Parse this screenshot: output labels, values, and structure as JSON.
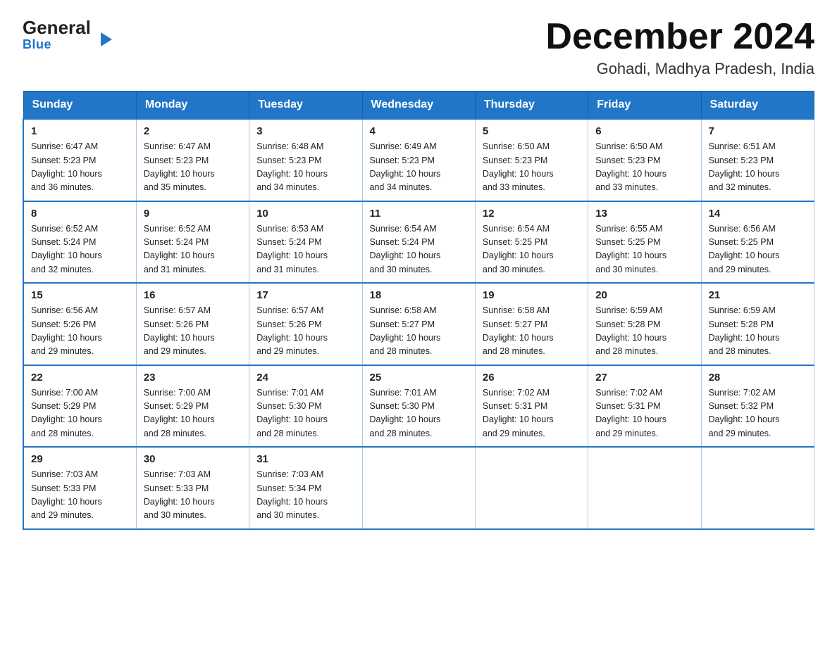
{
  "logo": {
    "general": "General",
    "arrow": "▶",
    "blue": "Blue"
  },
  "header": {
    "month_year": "December 2024",
    "location": "Gohadi, Madhya Pradesh, India"
  },
  "days_of_week": [
    "Sunday",
    "Monday",
    "Tuesday",
    "Wednesday",
    "Thursday",
    "Friday",
    "Saturday"
  ],
  "weeks": [
    [
      {
        "day": "1",
        "sunrise": "6:47 AM",
        "sunset": "5:23 PM",
        "daylight": "10 hours and 36 minutes."
      },
      {
        "day": "2",
        "sunrise": "6:47 AM",
        "sunset": "5:23 PM",
        "daylight": "10 hours and 35 minutes."
      },
      {
        "day": "3",
        "sunrise": "6:48 AM",
        "sunset": "5:23 PM",
        "daylight": "10 hours and 34 minutes."
      },
      {
        "day": "4",
        "sunrise": "6:49 AM",
        "sunset": "5:23 PM",
        "daylight": "10 hours and 34 minutes."
      },
      {
        "day": "5",
        "sunrise": "6:50 AM",
        "sunset": "5:23 PM",
        "daylight": "10 hours and 33 minutes."
      },
      {
        "day": "6",
        "sunrise": "6:50 AM",
        "sunset": "5:23 PM",
        "daylight": "10 hours and 33 minutes."
      },
      {
        "day": "7",
        "sunrise": "6:51 AM",
        "sunset": "5:23 PM",
        "daylight": "10 hours and 32 minutes."
      }
    ],
    [
      {
        "day": "8",
        "sunrise": "6:52 AM",
        "sunset": "5:24 PM",
        "daylight": "10 hours and 32 minutes."
      },
      {
        "day": "9",
        "sunrise": "6:52 AM",
        "sunset": "5:24 PM",
        "daylight": "10 hours and 31 minutes."
      },
      {
        "day": "10",
        "sunrise": "6:53 AM",
        "sunset": "5:24 PM",
        "daylight": "10 hours and 31 minutes."
      },
      {
        "day": "11",
        "sunrise": "6:54 AM",
        "sunset": "5:24 PM",
        "daylight": "10 hours and 30 minutes."
      },
      {
        "day": "12",
        "sunrise": "6:54 AM",
        "sunset": "5:25 PM",
        "daylight": "10 hours and 30 minutes."
      },
      {
        "day": "13",
        "sunrise": "6:55 AM",
        "sunset": "5:25 PM",
        "daylight": "10 hours and 30 minutes."
      },
      {
        "day": "14",
        "sunrise": "6:56 AM",
        "sunset": "5:25 PM",
        "daylight": "10 hours and 29 minutes."
      }
    ],
    [
      {
        "day": "15",
        "sunrise": "6:56 AM",
        "sunset": "5:26 PM",
        "daylight": "10 hours and 29 minutes."
      },
      {
        "day": "16",
        "sunrise": "6:57 AM",
        "sunset": "5:26 PM",
        "daylight": "10 hours and 29 minutes."
      },
      {
        "day": "17",
        "sunrise": "6:57 AM",
        "sunset": "5:26 PM",
        "daylight": "10 hours and 29 minutes."
      },
      {
        "day": "18",
        "sunrise": "6:58 AM",
        "sunset": "5:27 PM",
        "daylight": "10 hours and 28 minutes."
      },
      {
        "day": "19",
        "sunrise": "6:58 AM",
        "sunset": "5:27 PM",
        "daylight": "10 hours and 28 minutes."
      },
      {
        "day": "20",
        "sunrise": "6:59 AM",
        "sunset": "5:28 PM",
        "daylight": "10 hours and 28 minutes."
      },
      {
        "day": "21",
        "sunrise": "6:59 AM",
        "sunset": "5:28 PM",
        "daylight": "10 hours and 28 minutes."
      }
    ],
    [
      {
        "day": "22",
        "sunrise": "7:00 AM",
        "sunset": "5:29 PM",
        "daylight": "10 hours and 28 minutes."
      },
      {
        "day": "23",
        "sunrise": "7:00 AM",
        "sunset": "5:29 PM",
        "daylight": "10 hours and 28 minutes."
      },
      {
        "day": "24",
        "sunrise": "7:01 AM",
        "sunset": "5:30 PM",
        "daylight": "10 hours and 28 minutes."
      },
      {
        "day": "25",
        "sunrise": "7:01 AM",
        "sunset": "5:30 PM",
        "daylight": "10 hours and 28 minutes."
      },
      {
        "day": "26",
        "sunrise": "7:02 AM",
        "sunset": "5:31 PM",
        "daylight": "10 hours and 29 minutes."
      },
      {
        "day": "27",
        "sunrise": "7:02 AM",
        "sunset": "5:31 PM",
        "daylight": "10 hours and 29 minutes."
      },
      {
        "day": "28",
        "sunrise": "7:02 AM",
        "sunset": "5:32 PM",
        "daylight": "10 hours and 29 minutes."
      }
    ],
    [
      {
        "day": "29",
        "sunrise": "7:03 AM",
        "sunset": "5:33 PM",
        "daylight": "10 hours and 29 minutes."
      },
      {
        "day": "30",
        "sunrise": "7:03 AM",
        "sunset": "5:33 PM",
        "daylight": "10 hours and 30 minutes."
      },
      {
        "day": "31",
        "sunrise": "7:03 AM",
        "sunset": "5:34 PM",
        "daylight": "10 hours and 30 minutes."
      },
      null,
      null,
      null,
      null
    ]
  ],
  "labels": {
    "sunrise": "Sunrise:",
    "sunset": "Sunset:",
    "daylight": "Daylight:"
  }
}
